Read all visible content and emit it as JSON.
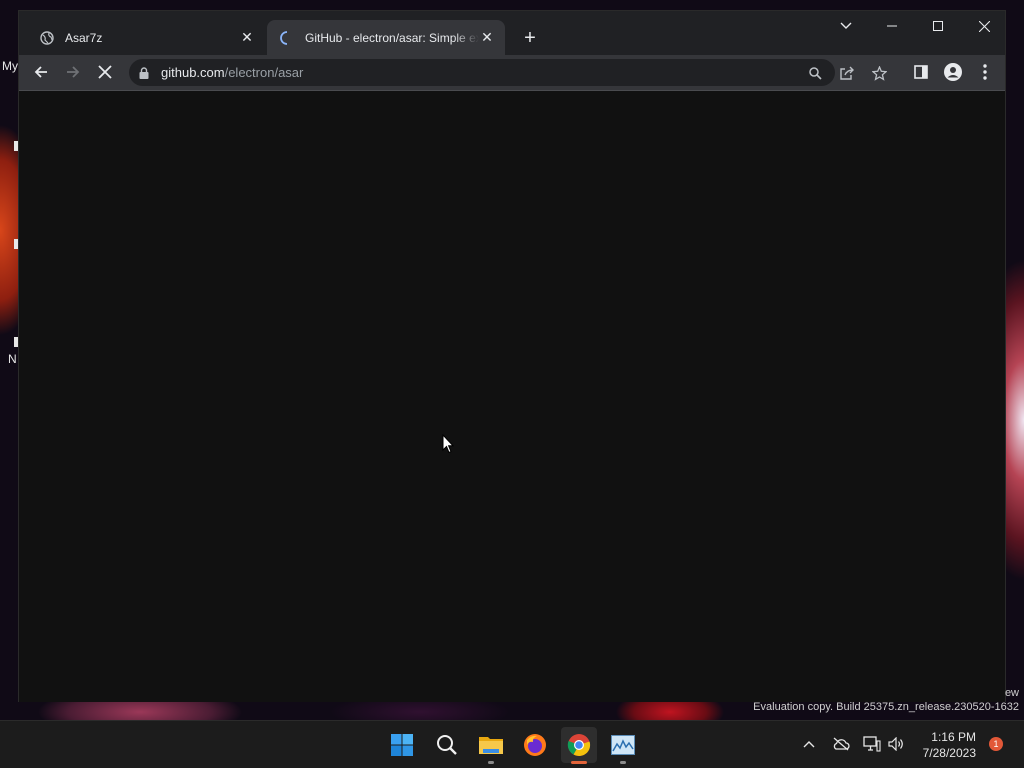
{
  "desktop": {
    "labels": [
      "My",
      "N"
    ]
  },
  "browser": {
    "tabs": [
      {
        "title": "Asar7z",
        "favicon": "globe-icon",
        "active": false
      },
      {
        "title": "GitHub - electron/asar: Simple extensive tar-like archive format with indexing",
        "favicon": "loading-spinner-icon",
        "active": true
      }
    ],
    "address": {
      "domain": "github.com",
      "path": "/electron/asar"
    },
    "colors": {
      "tabstrip": "#202124",
      "toolbar": "#35363a",
      "content": "#111111",
      "loading": "#8ab4f8"
    }
  },
  "watermark": {
    "line1": "ew",
    "line2": "Evaluation copy. Build 25375.zn_release.230520-1632"
  },
  "taskbar": {
    "apps": [
      "start-icon",
      "search-icon",
      "file-explorer-icon",
      "firefox-icon",
      "chrome-icon",
      "task-manager-icon"
    ],
    "clock": {
      "time": "1:16 PM",
      "date": "7/28/2023"
    },
    "notifications": "1"
  }
}
